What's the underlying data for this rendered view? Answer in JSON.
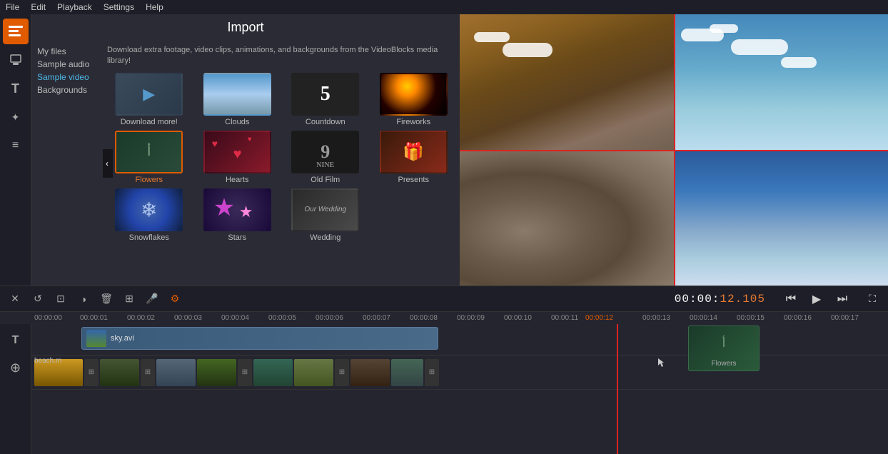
{
  "menu": {
    "items": [
      "File",
      "Edit",
      "Playback",
      "Settings",
      "Help"
    ]
  },
  "sidebar": {
    "buttons": [
      {
        "name": "import-btn",
        "icon": "▶",
        "active": true
      },
      {
        "name": "titles-btn",
        "icon": "T",
        "active": false
      },
      {
        "name": "text-btn",
        "icon": "T",
        "active": false
      },
      {
        "name": "overlay-btn",
        "icon": "✦",
        "active": false
      },
      {
        "name": "menu-btn",
        "icon": "≡",
        "active": false
      }
    ]
  },
  "import": {
    "title": "Import",
    "description": "Download extra footage, video clips, animations, and backgrounds from the VideoBlocks media library!",
    "nav": [
      {
        "label": "My files",
        "active": false
      },
      {
        "label": "Sample audio",
        "active": false
      },
      {
        "label": "Sample video",
        "active": true
      },
      {
        "label": "Backgrounds",
        "active": false
      }
    ],
    "thumbnails_row1": [
      {
        "label": "Download more!",
        "type": "download"
      },
      {
        "label": "Clouds",
        "type": "clouds"
      },
      {
        "label": "Countdown",
        "type": "countdown"
      },
      {
        "label": "Fireworks",
        "type": "fireworks"
      }
    ],
    "thumbnails_row2": [
      {
        "label": "Flowers",
        "type": "flowers",
        "selected": true
      },
      {
        "label": "Hearts",
        "type": "hearts"
      },
      {
        "label": "Old Film",
        "type": "oldfilm"
      },
      {
        "label": "Presents",
        "type": "presents"
      }
    ],
    "thumbnails_row3": [
      {
        "label": "Snowflakes",
        "type": "snowflakes"
      },
      {
        "label": "Stars",
        "type": "stars"
      },
      {
        "label": "Wedding",
        "type": "wedding"
      }
    ]
  },
  "timeline_toolbar": {
    "buttons": [
      "✕",
      "↺",
      "⊡",
      "◑",
      "🗑",
      "⊞",
      "🎤",
      "⚙"
    ],
    "time": "00:00:",
    "time_orange": "12.105",
    "transport": [
      "⏮",
      "▶",
      "⏭"
    ]
  },
  "ruler": {
    "ticks": [
      "00:00:00",
      "00:00:01",
      "00:00:02",
      "00:00:03",
      "00:00:04",
      "00:00:05",
      "00:00:06",
      "00:00:07",
      "00:00:08",
      "00:00:09",
      "00:00:10",
      "00:00:11",
      "00:00:12",
      "00:00:13",
      "00:00:14",
      "00:00:15",
      "00:00:16",
      "00:00:17"
    ]
  },
  "tracks": {
    "video_clip": "sky.avi",
    "flowers_clip": "Flowers",
    "beach_label": "beach.m"
  }
}
